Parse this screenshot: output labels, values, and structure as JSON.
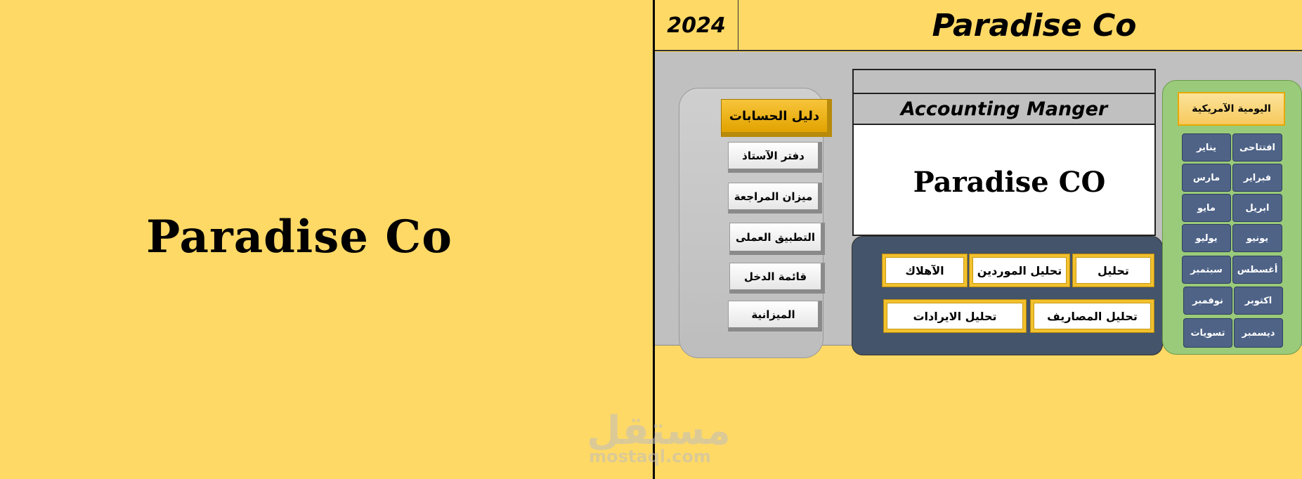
{
  "left_panel": {
    "title": "Paradise Co"
  },
  "header": {
    "year": "2024",
    "title": "Paradise Co"
  },
  "menu": {
    "main": "دليل الحسابات",
    "items": [
      "دفتر الآستاذ",
      "ميزان المراجعة",
      "التطبيق العملى",
      "قائمة الدخل",
      "الميزانية"
    ]
  },
  "center": {
    "subtitle": "Accounting Manger",
    "logo_text": "Paradise CO",
    "analysis": {
      "row1": [
        "تحليل",
        "تحليل الموردين",
        "الآهلاك"
      ],
      "row2": [
        "تحليل المصاريف",
        "تحليل الايرادات"
      ]
    }
  },
  "calendar": {
    "header": "اليومية الآمريكية",
    "months": [
      [
        "افتتاحى",
        "يناير"
      ],
      [
        "فبراير",
        "مارس"
      ],
      [
        "ابريل",
        "مايو"
      ],
      [
        "يونيو",
        "يوليو"
      ],
      [
        "أغسطس",
        "سبتمبر"
      ],
      [
        "اكتوبر",
        "نوفمبر"
      ],
      [
        "ديسمبر",
        "تسويات"
      ]
    ]
  },
  "watermark": {
    "logo": "مستقل",
    "url": "mostaql.com"
  },
  "colors": {
    "background": "#FFD966",
    "gray": "#C0C0C0",
    "navy": "#44546A",
    "green": "#9ACB7A",
    "gold": "#F2C12E"
  }
}
